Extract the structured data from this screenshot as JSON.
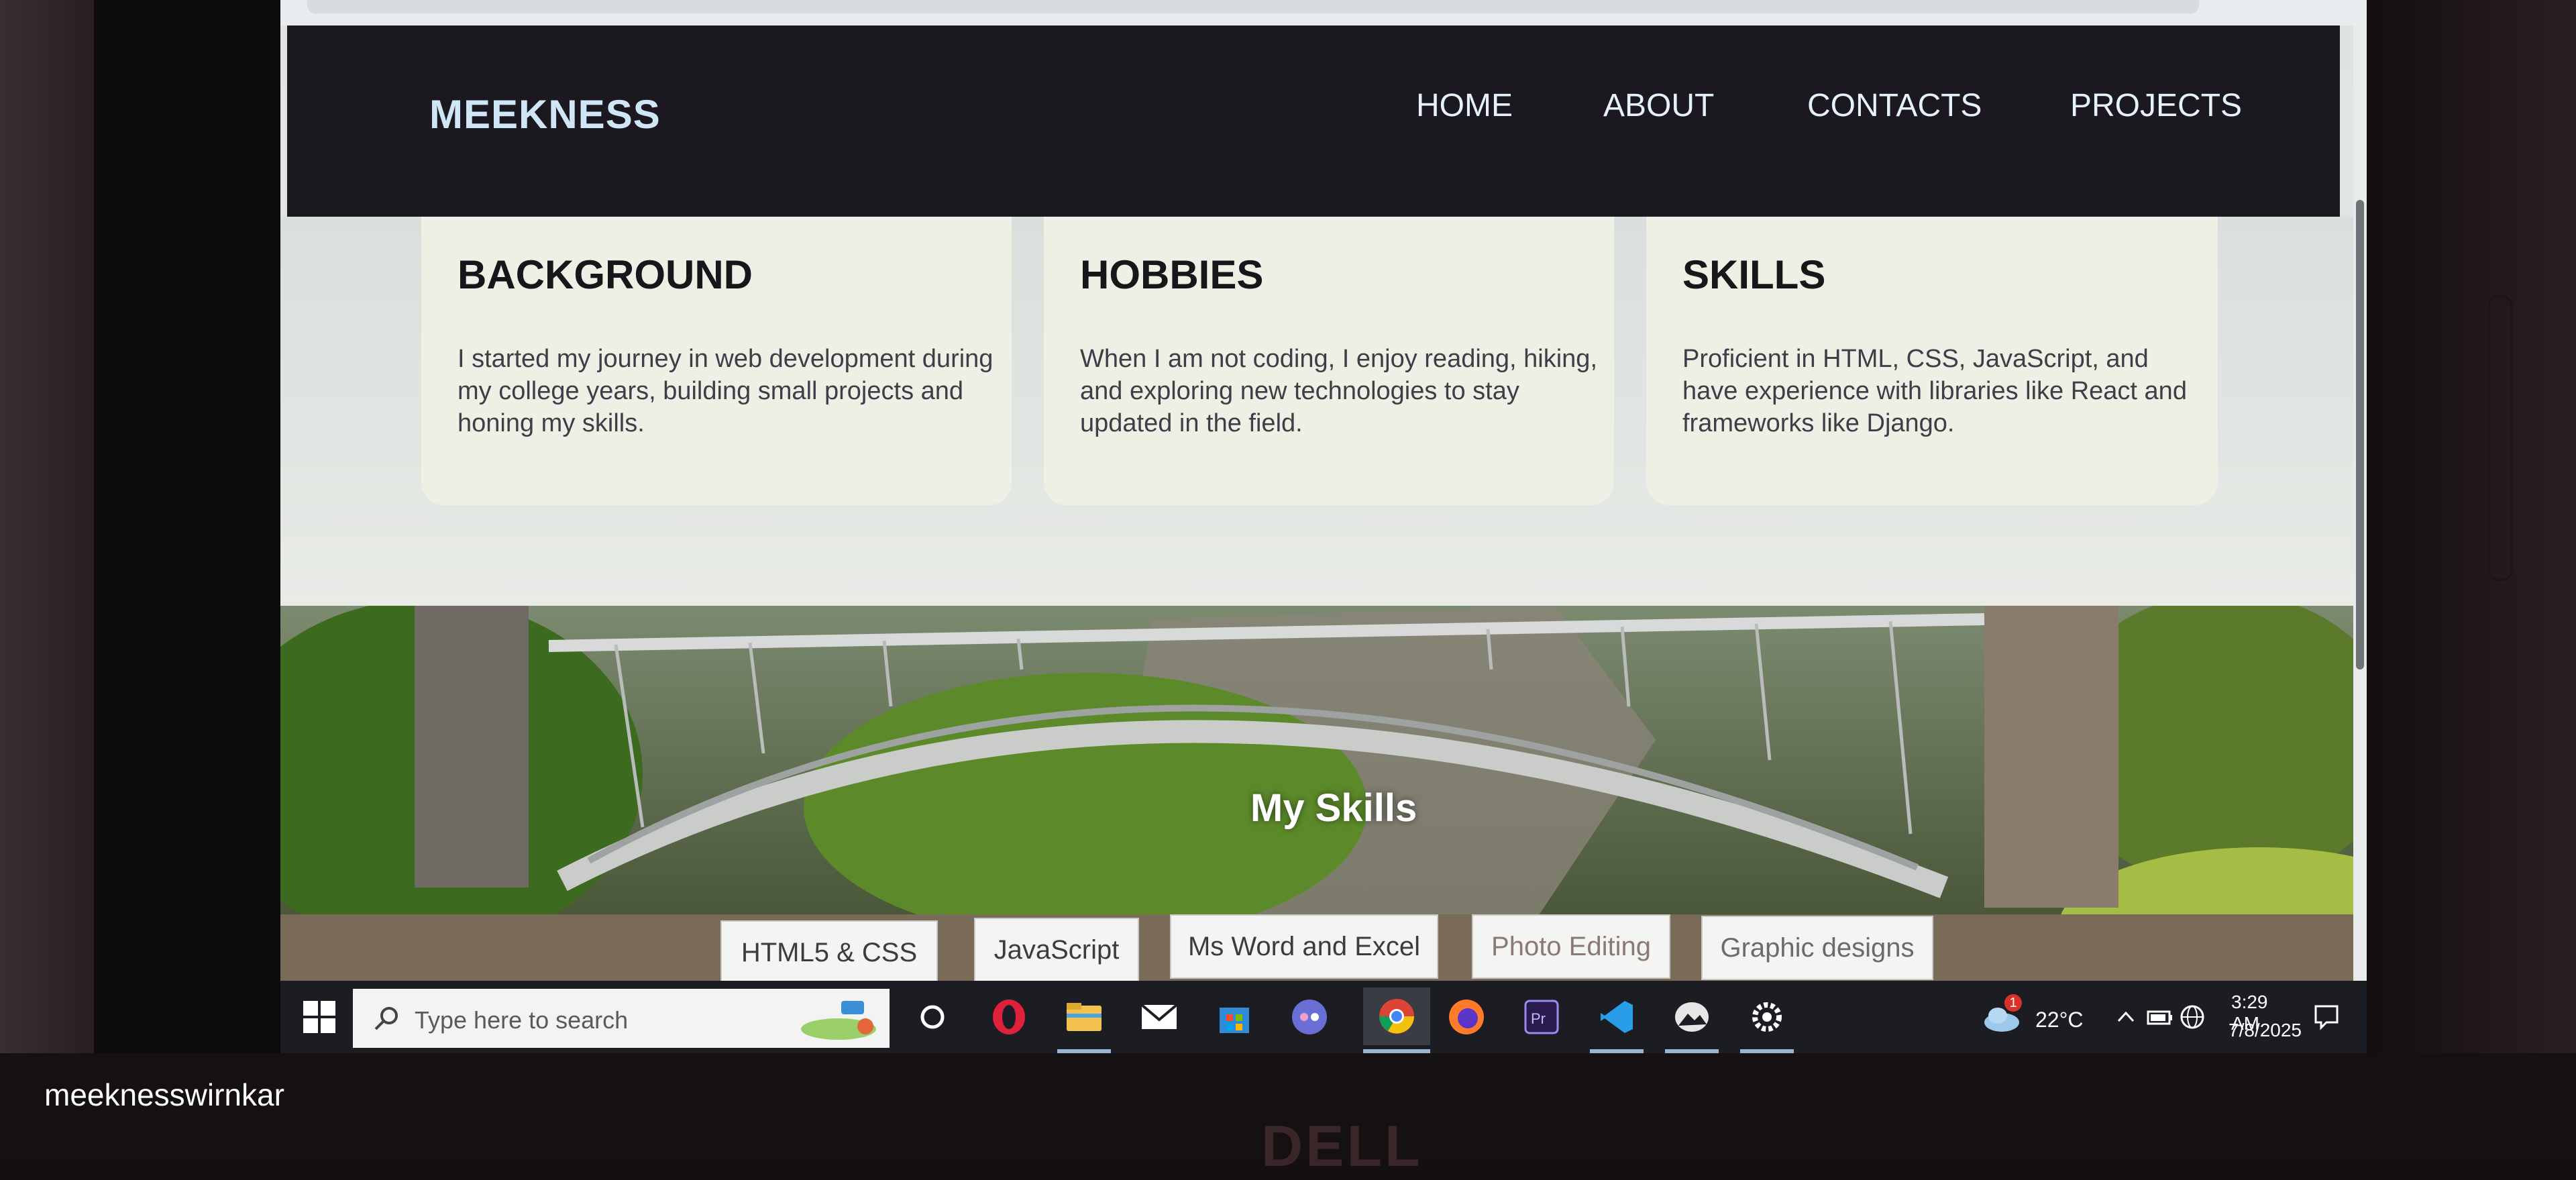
{
  "site": {
    "logo": "MEEKNESS",
    "nav": [
      "HOME",
      "ABOUT",
      "CONTACTS",
      "PROJECTS"
    ]
  },
  "cards": [
    {
      "title": "BACKGROUND",
      "text": "I started my journey in web development during my college years, building small projects and honing my skills."
    },
    {
      "title": "HOBBIES",
      "text": "When I am not coding, I enjoy reading, hiking, and exploring new technologies to stay updated in the field."
    },
    {
      "title": "SKILLS",
      "text": "Proficient in HTML, CSS, JavaScript, and have experience with libraries like React and frameworks like Django."
    }
  ],
  "skills": {
    "title": "My Skills",
    "items": [
      "HTML5 & CSS",
      "JavaScript",
      "Ms Word and Excel",
      "Photo Editing",
      "Graphic designs"
    ]
  },
  "taskbar": {
    "search_placeholder": "Type here to search",
    "weather": "22°C",
    "weather_badge": "1",
    "time": "3:29 AM",
    "date": "7/8/2025",
    "apps": [
      "cortana-icon",
      "opera-icon",
      "file-explorer-icon",
      "mail-icon",
      "store-icon",
      "discord-icon",
      "chrome-icon",
      "firefox-icon",
      "premiere-icon",
      "vscode-icon",
      "photos-icon",
      "settings-icon"
    ]
  },
  "overlay": {
    "watermark": "meeknesswirnkar",
    "brand": "DELL"
  },
  "colors": {
    "header_bg": "#1b181f",
    "card_bg": "#eef0e6",
    "taskbar_bg": "#1c1d22"
  }
}
